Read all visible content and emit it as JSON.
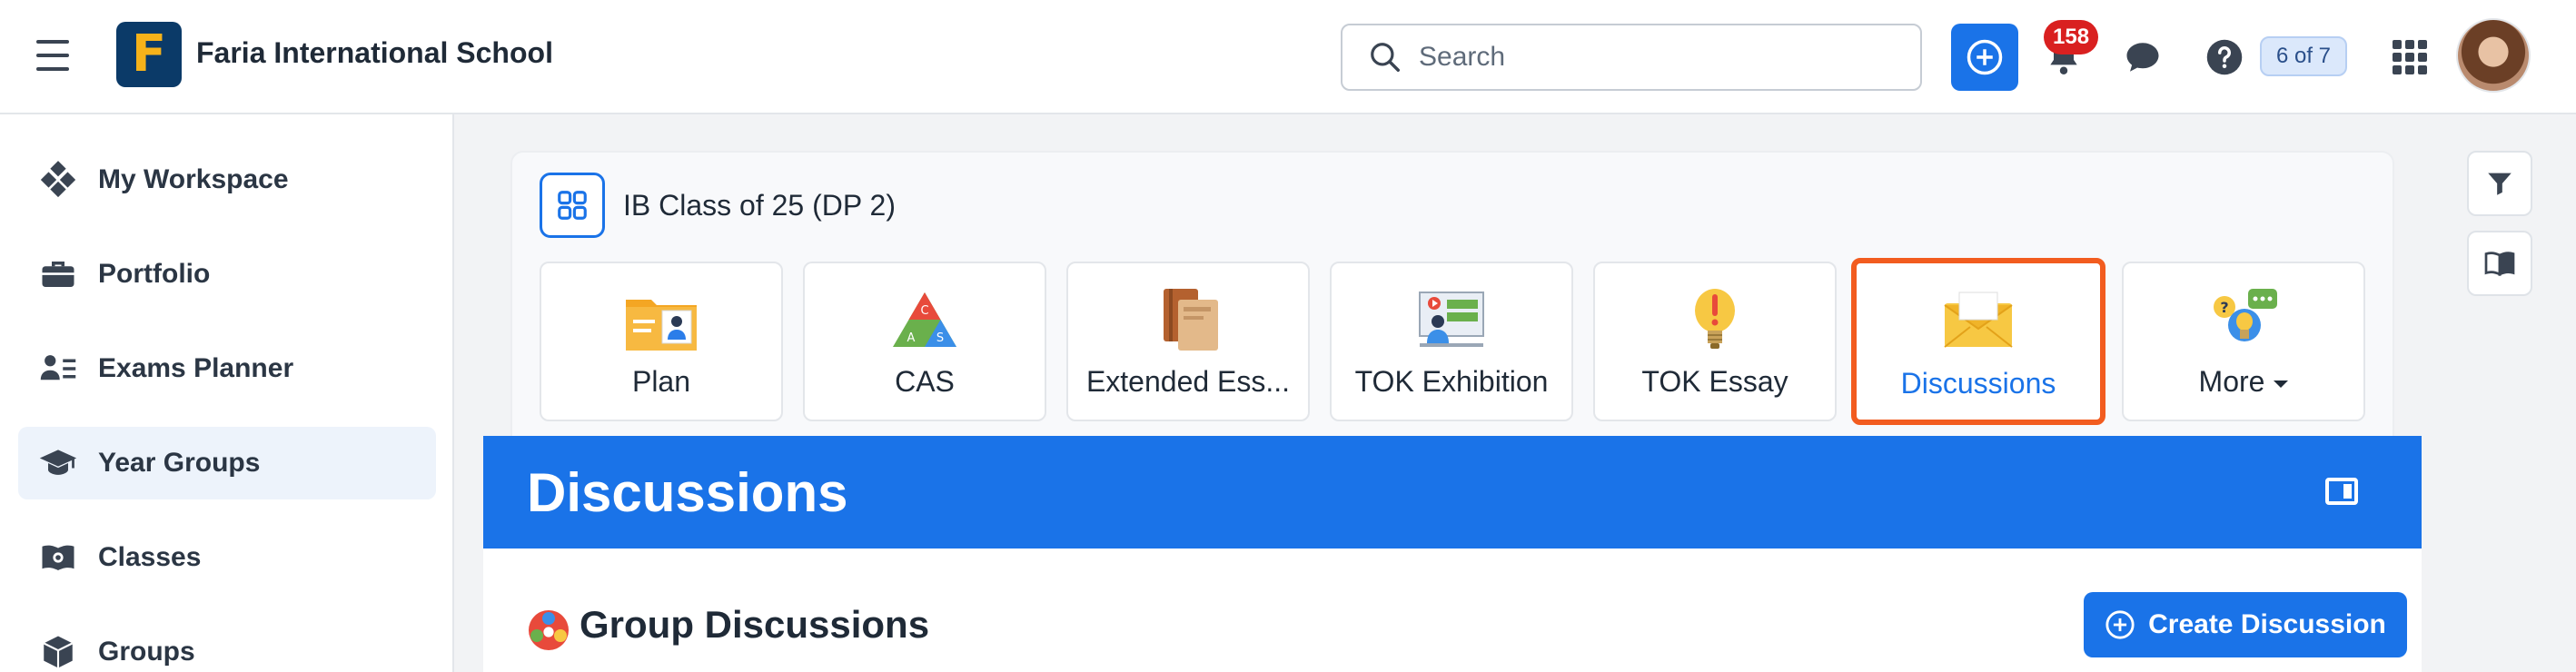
{
  "app": {
    "school_name": "Faria International School",
    "logo_letter": "F"
  },
  "header": {
    "search_placeholder": "Search",
    "notification_count": "158",
    "steps_badge": "6 of 7"
  },
  "sidebar": {
    "items": [
      {
        "label": "My Workspace",
        "icon": "workspace-icon"
      },
      {
        "label": "Portfolio",
        "icon": "briefcase-icon"
      },
      {
        "label": "Exams Planner",
        "icon": "exams-planner-icon"
      },
      {
        "label": "Year Groups",
        "icon": "graduation-cap-icon",
        "active": true
      },
      {
        "label": "Classes",
        "icon": "classes-book-icon"
      },
      {
        "label": "Groups",
        "icon": "groups-box-icon"
      }
    ]
  },
  "class_card": {
    "title": "IB Class of 25 (DP 2)",
    "tiles": [
      {
        "label": "Plan",
        "icon": "plan-folder-icon"
      },
      {
        "label": "CAS",
        "icon": "cas-triangle-icon"
      },
      {
        "label": "Extended Ess...",
        "icon": "extended-essay-books-icon"
      },
      {
        "label": "TOK Exhibition",
        "icon": "tok-exhibition-icon"
      },
      {
        "label": "TOK Essay",
        "icon": "tok-essay-bulb-icon"
      },
      {
        "label": "Discussions",
        "icon": "discussions-envelope-icon",
        "selected": true
      },
      {
        "label": "More",
        "icon": "more-bulb-chat-icon"
      }
    ]
  },
  "discussions": {
    "title": "Discussions",
    "section_title": "Group Discussions",
    "create_button": "Create Discussion"
  },
  "colors": {
    "primary": "#1a73e8",
    "highlight": "#f25c1f",
    "badge": "#d92020"
  }
}
